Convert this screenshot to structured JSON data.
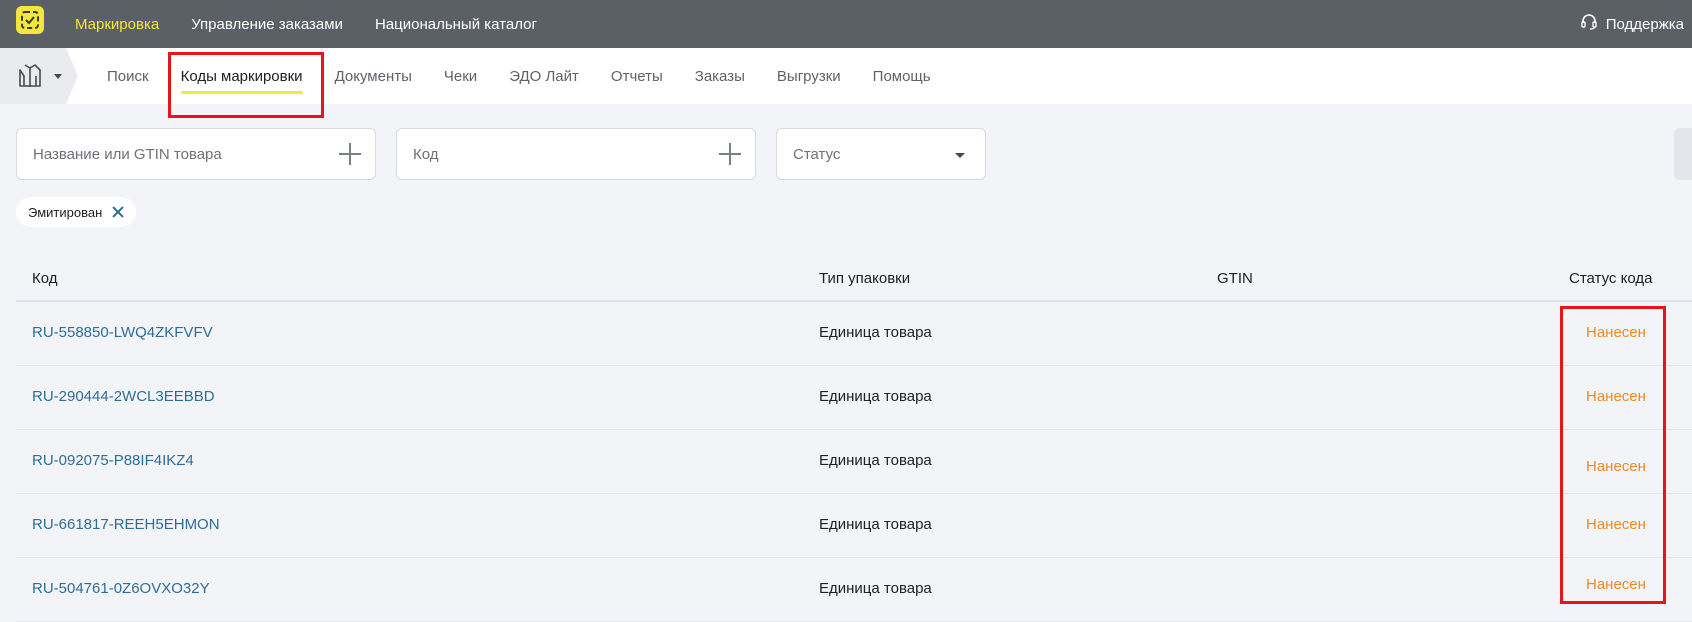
{
  "topbar": {
    "nav": [
      "Маркировка",
      "Управление заказами",
      "Национальный каталог"
    ],
    "support_label": "Поддержка"
  },
  "subnav": {
    "tabs": [
      "Поиск",
      "Коды маркировки",
      "Документы",
      "Чеки",
      "ЭДО Лайт",
      "Отчеты",
      "Заказы",
      "Выгрузки",
      "Помощь"
    ],
    "active_tab": "Коды маркировки"
  },
  "filters": {
    "name_placeholder": "Название или GTIN товара",
    "code_placeholder": "Код",
    "status_placeholder": "Статус",
    "active_chip": "Эмитирован"
  },
  "table": {
    "headers": [
      "Код",
      "Тип упаковки",
      "GTIN",
      "Статус кода"
    ],
    "rows": [
      {
        "code": "RU-558850-LWQ4ZKFVFV",
        "package": "Единица товара",
        "gtin": "",
        "status": "Нанесен"
      },
      {
        "code": "RU-290444-2WCL3EEBBD",
        "package": "Единица товара",
        "gtin": "",
        "status": "Нанесен"
      },
      {
        "code": "RU-092075-P88IF4IKZ4",
        "package": "Единица товара",
        "gtin": "",
        "status": "Нанесен"
      },
      {
        "code": "RU-661817-REEH5EHMON",
        "package": "Единица товара",
        "gtin": "",
        "status": "Нанесен"
      },
      {
        "code": "RU-504761-0Z6OVXO32Y",
        "package": "Единица товара",
        "gtin": "",
        "status": "Нанесен"
      }
    ]
  },
  "colors": {
    "topbar_bg": "#5b6066",
    "accent_yellow": "#f5e63a",
    "link_blue": "#2e6d9a",
    "status_orange": "#f08a24",
    "highlight_red": "#e8141b"
  },
  "icons": {
    "logo": "marking-logo-icon",
    "support": "headset-icon",
    "category": "jacket-icon",
    "add": "plus-icon",
    "dropdown": "chevron-down-icon",
    "remove_chip": "close-icon"
  }
}
